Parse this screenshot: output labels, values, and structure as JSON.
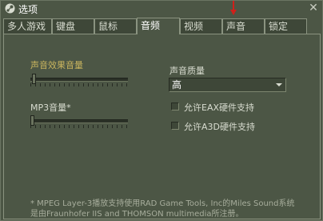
{
  "window": {
    "title": "选项",
    "close_glyph": "✕",
    "title_icon": "steam-icon"
  },
  "tabs": [
    {
      "label": "多人游戏",
      "active": false
    },
    {
      "label": "键盘",
      "active": false
    },
    {
      "label": "鼠标",
      "active": false
    },
    {
      "label": "音频",
      "active": true
    },
    {
      "label": "视频",
      "active": false
    },
    {
      "label": "声音",
      "active": false
    },
    {
      "label": "锁定",
      "active": false
    }
  ],
  "audio": {
    "effects_volume_label": "声音效果音量",
    "effects_volume_level": 0.02,
    "mp3_volume_label": "MP3音量*",
    "mp3_volume_level": 0.0,
    "quality_label": "声音质量",
    "quality_value": "高",
    "eax_label": "允许EAX硬件支持",
    "eax_checked": false,
    "a3d_label": "允许A3D硬件支持",
    "a3d_checked": false
  },
  "footnote": {
    "line1": "* MPEG Layer-3播放支持使用RAD Game Tools, Inc的Miles Sound系统",
    "line2": "是由Fraunhofer IIS and THOMSON multimedia所注册。"
  },
  "colors": {
    "background": "#4c5645",
    "accent_gold": "#c9b45e",
    "annotation_red": "#d0201a"
  }
}
